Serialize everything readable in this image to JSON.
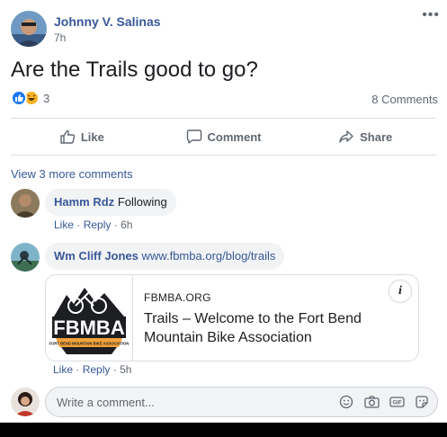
{
  "post": {
    "author": "Johnny V. Salinas",
    "time": "7h",
    "more_icon": "more-dots-icon",
    "text": "Are the Trails good to go?",
    "reaction_count": "3",
    "reaction_icons": [
      "like-reaction-icon",
      "haha-reaction-icon"
    ],
    "comments_count": "8 Comments"
  },
  "actions": {
    "like": "Like",
    "comment": "Comment",
    "share": "Share"
  },
  "comments": {
    "view_more": "View 3 more comments",
    "items": [
      {
        "author": "Hamm Rdz",
        "text": "Following",
        "like": "Like",
        "reply": "Reply",
        "sep": "·",
        "time": "6h"
      },
      {
        "author": "Wm Cliff Jones",
        "text": "www.fbmba.org/blog/trails",
        "like": "Like",
        "reply": "Reply",
        "sep": "·",
        "time": "5h",
        "link_preview": {
          "domain": "FBMBA.ORG",
          "title": "Trails – Welcome to the Fort Bend Mountain Bike Association",
          "logo_text": "FBMBA",
          "logo_ribbon": "FORT BEND MOUNTAIN BIKE ASSOCIATION",
          "info_label": "i"
        }
      }
    ]
  },
  "composer": {
    "placeholder": "Write a comment...",
    "icons": [
      "emoji-icon",
      "camera-icon",
      "gif-icon",
      "sticker-icon"
    ]
  },
  "colors": {
    "link": "#385898",
    "meta": "#606770",
    "bubble": "#f2f3f5",
    "like_blue": "#1877f2",
    "haha_yellow": "#f7b125",
    "logo_orange": "#f0a23a"
  }
}
